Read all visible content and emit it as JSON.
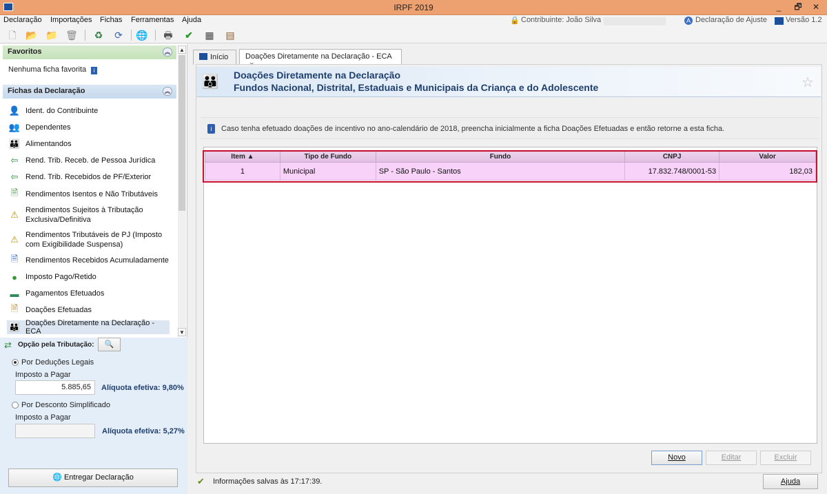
{
  "window": {
    "title": "IRPF 2019",
    "controls": [
      "_",
      "🗗",
      "✕"
    ]
  },
  "menu": [
    "Declaração",
    "Importações",
    "Fichas",
    "Ferramentas",
    "Ajuda"
  ],
  "status_bar_top": {
    "contribuinte": "Contribuinte: João Silva -",
    "tipo": "Declaração de Ajuste",
    "versao": "Versão 1.2"
  },
  "toolbar": [
    "new-doc-icon",
    "open-folder-icon",
    "folder-icon",
    "trash-icon",
    "recycle-icon",
    "import-icon",
    "globe-icon",
    "print-icon",
    "check-icon",
    "calculator-icon",
    "book-icon"
  ],
  "sidebar": {
    "favoritos_title": "Favoritos",
    "favoritos_empty": "Nenhuma ficha favorita",
    "fichas_title": "Fichas da Declaração",
    "items": [
      {
        "label": "Ident. do Contribuinte",
        "icon": "person-icon"
      },
      {
        "label": "Dependentes",
        "icon": "dependents-icon"
      },
      {
        "label": "Alimentandos",
        "icon": "people-icon"
      },
      {
        "label": "Rend. Trib. Receb. de Pessoa Jurídica",
        "icon": "money-arrow-icon"
      },
      {
        "label": "Rend. Trib. Recebidos de PF/Exterior",
        "icon": "money-arrow-icon"
      },
      {
        "label": "Rendimentos Isentos e Não Tributáveis",
        "icon": "doc-check-icon"
      },
      {
        "label": "Rendimentos Sujeitos à Tributação Exclusiva/Definitiva",
        "icon": "doc-warning-icon"
      },
      {
        "label": "Rendimentos Tributáveis de PJ (Imposto com Exigibilidade Suspensa)",
        "icon": "money-warning-icon"
      },
      {
        "label": "Rendimentos Recebidos Acumuladamente",
        "icon": "doc-clock-icon"
      },
      {
        "label": "Imposto Pago/Retido",
        "icon": "coin-hand-icon"
      },
      {
        "label": "Pagamentos Efetuados",
        "icon": "card-icon"
      },
      {
        "label": "Doações Efetuadas",
        "icon": "donation-doc-icon"
      },
      {
        "label": "Doações Diretamente na Declaração - ECA",
        "icon": "eca-icon"
      }
    ]
  },
  "opcao": {
    "title": "Opção pela Tributação:",
    "deducoes_label": "Por Deduções Legais",
    "imposto_label": "Imposto a Pagar",
    "imposto_value": "5.885,65",
    "aliquota1": "Alíquota efetiva: 9,80%",
    "simplificado_label": "Por Desconto Simplificado",
    "imposto_label2": "Imposto a Pagar",
    "imposto_value2": "",
    "aliquota2": "Alíquota efetiva: 5,27%",
    "entregar": "Entregar Declaração"
  },
  "tabs": [
    {
      "label": "Início"
    },
    {
      "label": "Doações Diretamente na Declaração - ECA",
      "close": "×"
    }
  ],
  "header": {
    "title": "Doações Diretamente na Declaração",
    "subtitle": "Fundos Nacional, Distrital, Estaduais e Municipais da Criança e do Adolescente",
    "star": "☆"
  },
  "info": "Caso tenha efetuado doações de incentivo no ano-calendário de 2018, preencha inicialmente a ficha Doações Efetuadas e então retorne a esta ficha.",
  "table": {
    "headers": [
      "Item ▲",
      "Tipo de Fundo",
      "Fundo",
      "CNPJ",
      "Valor"
    ],
    "rows": [
      [
        "1",
        "Municipal",
        "SP - São Paulo - Santos",
        "17.832.748/0001-53",
        "182,03"
      ]
    ]
  },
  "buttons": {
    "novo": "Novo",
    "editar": "Editar",
    "excluir": "Excluir",
    "ajuda": "Ajuda"
  },
  "status": "Informações salvas às 17:17:39.",
  "colors": {
    "titlebar": "#eda070",
    "row_highlight": "#f8d2f8",
    "selection_border": "#c8102e",
    "header_text": "#1f3f6e"
  }
}
